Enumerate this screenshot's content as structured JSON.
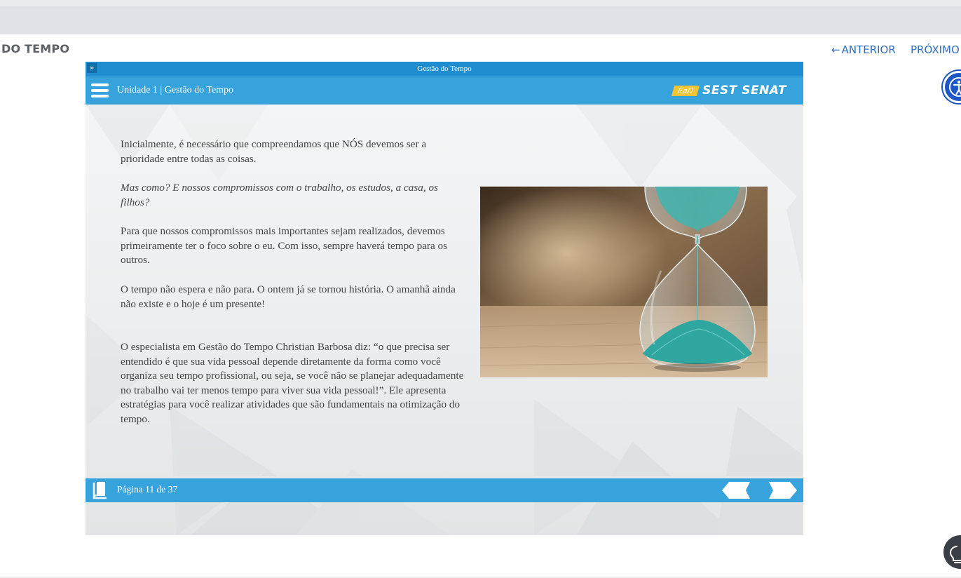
{
  "page": {
    "course_title": "DO TEMPO",
    "nav": {
      "prev_label": "ANTERIOR",
      "next_label": "PRÓXIMO",
      "prev_arrow": "←"
    }
  },
  "player": {
    "window_title": "Gestão do Tempo",
    "expand_glyph": "»",
    "header": {
      "unit_label": "Unidade 1 | Gestão do Tempo",
      "logo_ead": "EaD",
      "logo_brand": "SEST SENAT"
    },
    "content": {
      "paragraphs": [
        "Inicialmente, é necessário que compreendamos que NÓS devemos ser a prioridade entre todas as coisas.",
        "Mas como? E nossos compromissos com o trabalho, os estudos, a casa, os filhos?",
        "Para que nossos compromissos mais importantes sejam realizados, devemos primeiramente ter o foco sobre o eu. Com isso, sempre haverá tempo para os outros.",
        "O tempo não espera e não para. O ontem já se tornou história. O amanhã ainda não existe e o hoje é um presente!",
        "O especialista em Gestão do Tempo Christian Barbosa diz: “o que precisa ser entendido é que sua vida pessoal depende diretamente da forma como você organiza seu tempo profissional, ou seja, se você não se planejar adequadamente no trabalho vai ter menos tempo para viver sua vida pessoal!”. Ele apresenta estratégias para você realizar atividades que são fundamentais na otimização do tempo."
      ],
      "image_subject": "hourglass-with-teal-sand"
    },
    "footer": {
      "page_label": "Página 11 de 37"
    }
  },
  "colors": {
    "player_blue": "#36a3dd",
    "titlebar_blue": "#1f8ed0",
    "link_blue": "#2f6fbd",
    "logo_yellow": "#f3c42f",
    "sand_teal": "#3fb5b0"
  },
  "icons": [
    "expand-icon",
    "menu-icon",
    "book-icon",
    "prev-arrow-icon",
    "next-arrow-icon",
    "accessibility-icon",
    "lightbulb-icon",
    "back-arrow-icon"
  ]
}
